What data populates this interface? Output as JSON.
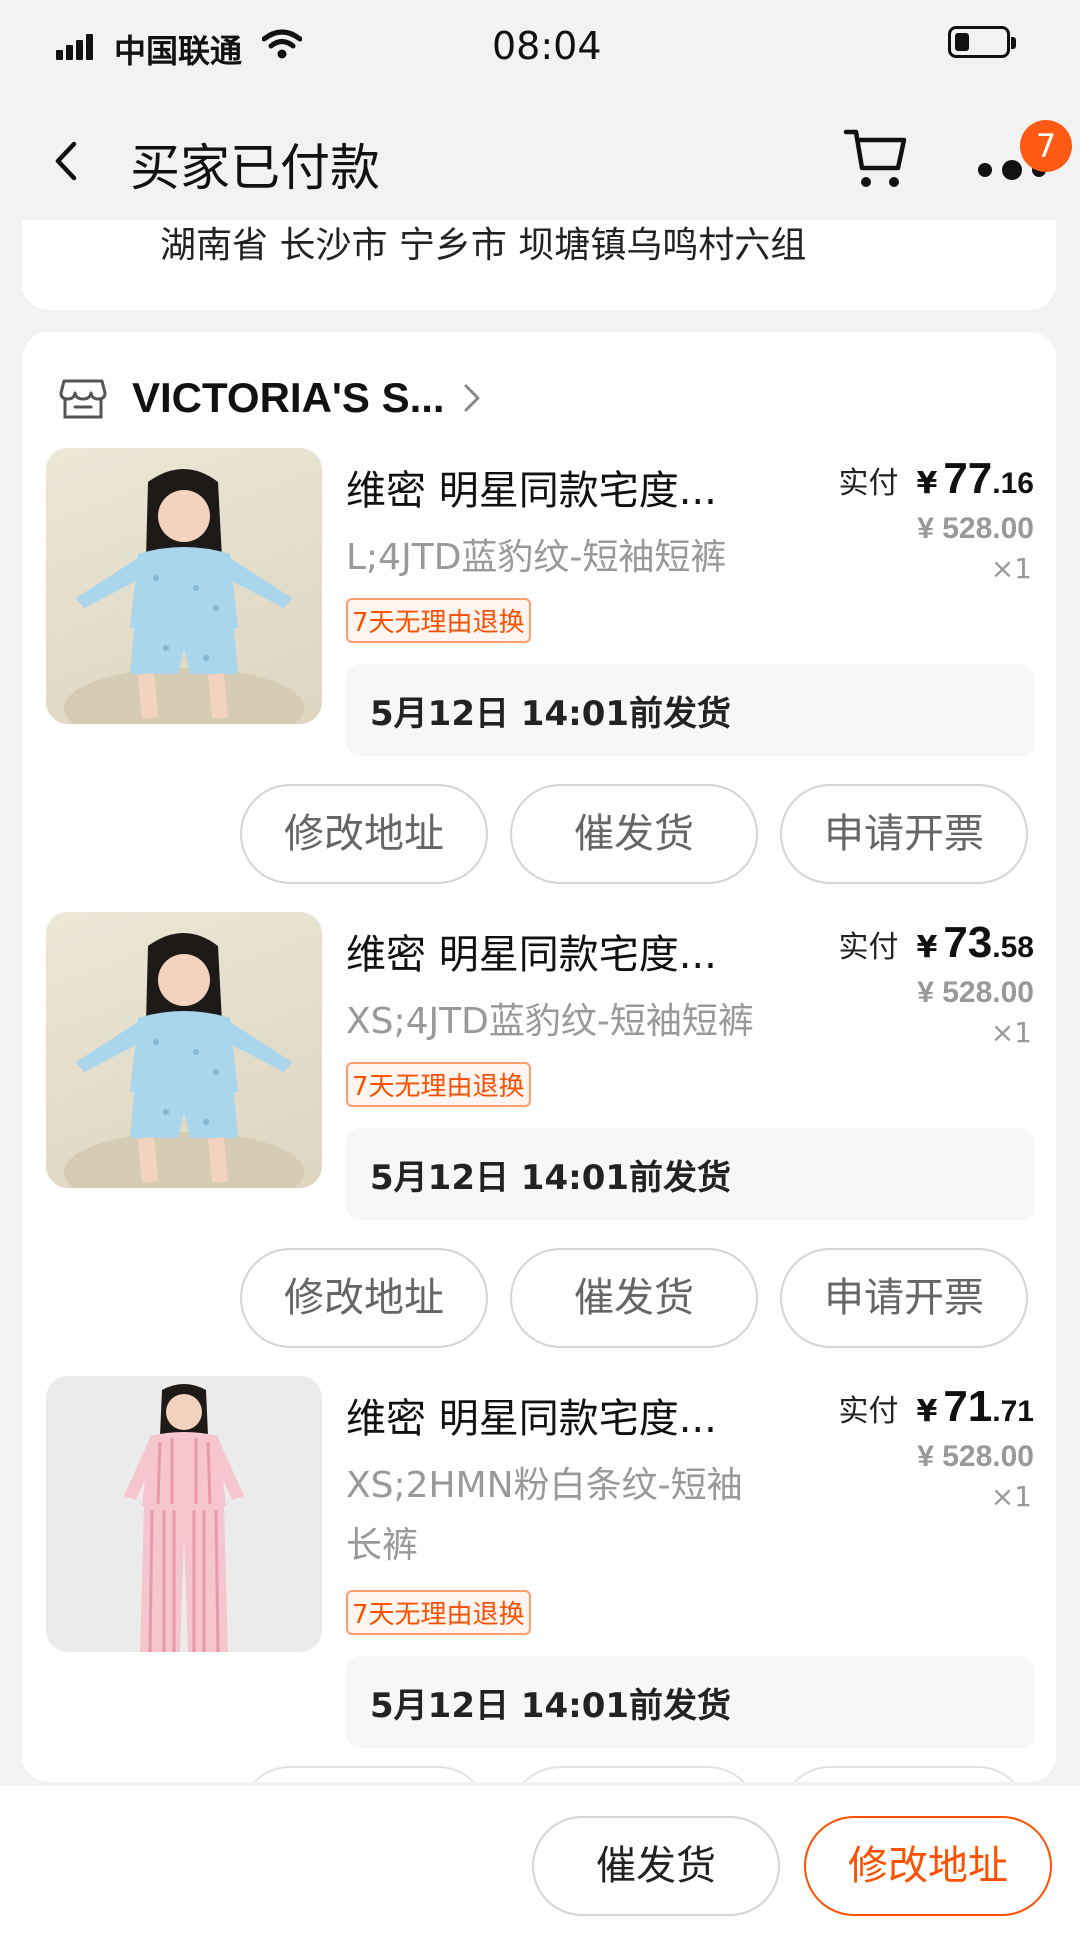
{
  "status_bar": {
    "carrier": "中国联通",
    "time": "08:04"
  },
  "nav": {
    "title": "买家已付款",
    "more_badge": "7"
  },
  "address": {
    "text": "湖南省 长沙市 宁乡市 坝塘镇乌鸣村六组"
  },
  "shop": {
    "name": "VICTORIA'S S..."
  },
  "items": [
    {
      "title": "维密 明星同款宅度...",
      "sku": "L;4JTD蓝豹纹-短袖短裤",
      "tag": "7天无理由退换",
      "paid_label": "实付",
      "paid_currency": "¥",
      "paid_int": "77",
      "paid_dec": ".16",
      "original_price": "¥ 528.00",
      "quantity": "×1",
      "ship_note": "5月12日 14:01前发货",
      "buttons": [
        "修改地址",
        "催发货",
        "申请开票"
      ]
    },
    {
      "title": "维密 明星同款宅度...",
      "sku": "XS;4JTD蓝豹纹-短袖短裤",
      "tag": "7天无理由退换",
      "paid_label": "实付",
      "paid_currency": "¥",
      "paid_int": "73",
      "paid_dec": ".58",
      "original_price": "¥ 528.00",
      "quantity": "×1",
      "ship_note": "5月12日 14:01前发货",
      "buttons": [
        "修改地址",
        "催发货",
        "申请开票"
      ]
    },
    {
      "title": "维密 明星同款宅度...",
      "sku": "XS;2HMN粉白条纹-短袖长裤",
      "tag": "7天无理由退换",
      "paid_label": "实付",
      "paid_currency": "¥",
      "paid_int": "71",
      "paid_dec": ".71",
      "original_price": "¥ 528.00",
      "quantity": "×1",
      "ship_note": "5月12日 14:01前发货"
    }
  ],
  "bottom_bar": {
    "remind_label": "催发货",
    "address_label": "修改地址"
  },
  "colors": {
    "accent": "#ff5000",
    "badge": "#ff5a14",
    "background": "#f2f2f2"
  }
}
